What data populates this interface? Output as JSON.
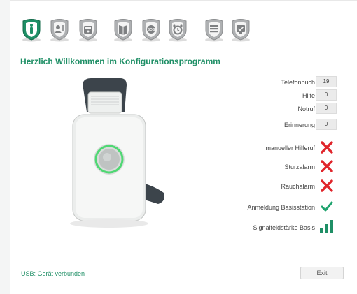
{
  "toolbar": {
    "icons": [
      {
        "name": "info-icon",
        "active": true
      },
      {
        "name": "contacts-icon"
      },
      {
        "name": "basestation-icon"
      },
      {
        "name": "phonebook-icon"
      },
      {
        "name": "sos-icon"
      },
      {
        "name": "alarm-clock-icon"
      },
      {
        "name": "settings-list-icon"
      },
      {
        "name": "monitor-check-icon"
      }
    ],
    "active_color": "#1f8f66"
  },
  "welcome_title": "Herzlich Willkommen im Konfigurationsprogramm",
  "counters": [
    {
      "label": "Telefonbuch",
      "value": "19"
    },
    {
      "label": "Hilfe",
      "value": "0"
    },
    {
      "label": "Notruf",
      "value": "0"
    },
    {
      "label": "Erinnerung",
      "value": "0"
    }
  ],
  "features": [
    {
      "label": "manueller Hilferuf",
      "status": "off",
      "icon": "red-x-icon"
    },
    {
      "label": "Sturzalarm",
      "status": "off",
      "icon": "red-x-icon"
    },
    {
      "label": "Rauchalarm",
      "status": "off",
      "icon": "red-x-icon"
    },
    {
      "label": "Anmeldung Basisstation",
      "status": "on",
      "icon": "green-check-icon"
    }
  ],
  "signal": {
    "label": "Signalfeldstärke Basis",
    "bars_active": 3,
    "bars_total": 3
  },
  "footer": {
    "usb_status": "USB: Gerät verbunden",
    "exit_label": "Exit"
  },
  "colors": {
    "accent": "#1f8f66",
    "error": "#e0252b",
    "ok": "#1ea36e"
  }
}
